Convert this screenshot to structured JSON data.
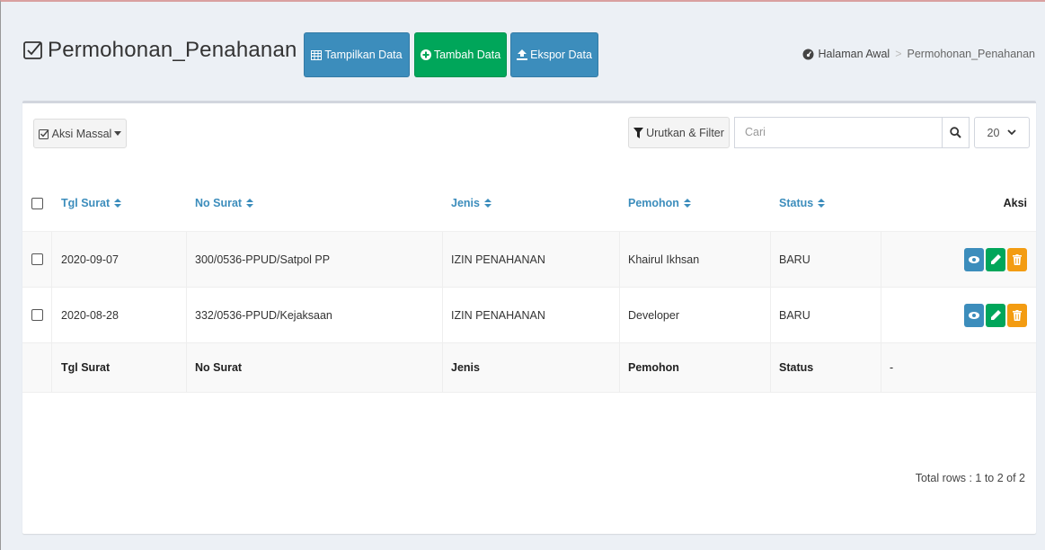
{
  "header": {
    "title": "Permohonan_Penahanan",
    "buttons": {
      "tampilkan": "Tampilkan Data",
      "tambah": "Tambah Data",
      "ekspor": "Ekspor Data"
    },
    "breadcrumb": {
      "home": "Halaman Awal",
      "separator": ">",
      "current": "Permohonan_Penahanan"
    }
  },
  "toolbar": {
    "aksi_massal": "Aksi Massal",
    "filter": "Urutkan & Filter",
    "search_placeholder": "Cari",
    "per_page": "20"
  },
  "table": {
    "columns": [
      "Tgl Surat",
      "No Surat",
      "Jenis",
      "Pemohon",
      "Status",
      "Aksi"
    ],
    "rows": [
      {
        "tgl": "2020-09-07",
        "no": "300/0536-PPUD/Satpol PP",
        "jenis": "IZIN PENAHANAN",
        "pemohon": "Khairul Ikhsan",
        "status": "BARU"
      },
      {
        "tgl": "2020-08-28",
        "no": "332/0536-PPUD/Kejaksaan",
        "jenis": "IZIN PENAHANAN",
        "pemohon": "Developer",
        "status": "BARU"
      }
    ],
    "footer": {
      "tgl": "Tgl Surat",
      "no": "No Surat",
      "jenis": "Jenis",
      "pemohon": "Pemohon",
      "status": "Status",
      "aksi": "-"
    }
  },
  "pagination": {
    "total_text": "Total rows : 1 to 2 of 2"
  },
  "colors": {
    "primary": "#3c8dbc",
    "success": "#00a65a",
    "warning": "#f39c12"
  }
}
